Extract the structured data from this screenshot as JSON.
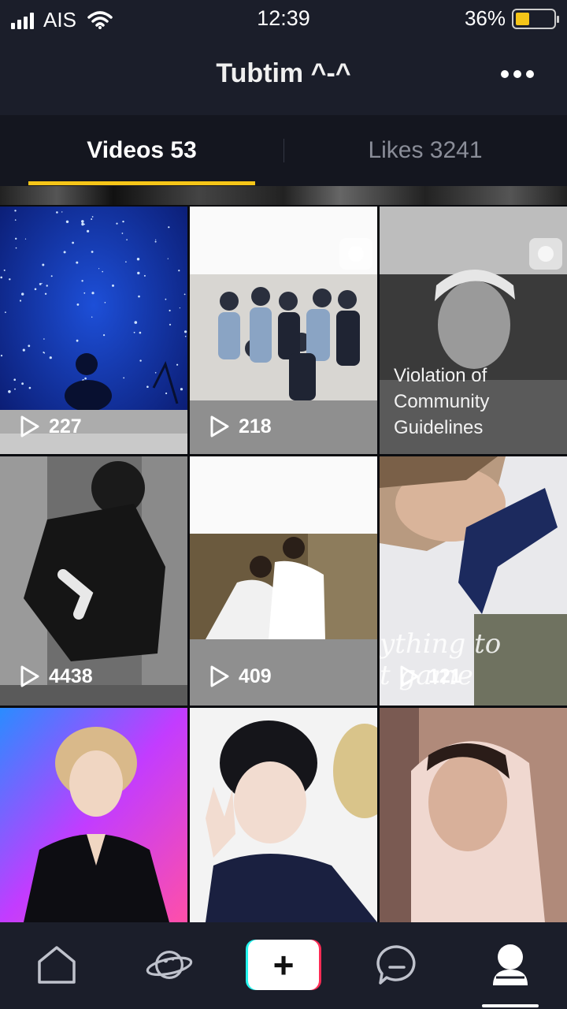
{
  "status_bar": {
    "carrier": "AIS",
    "time": "12:39",
    "battery_percent": "36%",
    "battery_level": 0.36,
    "battery_color": "#f5c518"
  },
  "header": {
    "title": "Tubtim ^-^",
    "more_icon": "more-horizontal-icon"
  },
  "tabs": [
    {
      "label": "Videos 53",
      "active": true
    },
    {
      "label": "Likes 3241",
      "active": false
    }
  ],
  "videos": [
    {
      "views": "227",
      "thumb": "starry-sky-silhouette"
    },
    {
      "views": "218",
      "thumb": "group-photo"
    },
    {
      "views": "",
      "thumb": "portrait-blurred",
      "notice": [
        "Violation of",
        "Community",
        "Guidelines"
      ]
    },
    {
      "views": "4438",
      "thumb": "bw-stage-dance"
    },
    {
      "views": "409",
      "thumb": "two-in-white"
    },
    {
      "views": "121",
      "thumb": "navy-scarf",
      "overlay_text": [
        "ything to",
        "t game"
      ]
    },
    {
      "views": "",
      "thumb": "blonde-stage"
    },
    {
      "views": "",
      "thumb": "peace-sign"
    },
    {
      "views": "",
      "thumb": "pink-hoodie"
    }
  ],
  "bottom_nav": {
    "items": [
      "home-icon",
      "discover-planet-icon",
      "create-plus-icon",
      "inbox-message-icon",
      "profile-icon"
    ],
    "create_label": "+"
  },
  "colors": {
    "accent": "#f5c518",
    "background": "#14161f",
    "bar": "#1b1e2a"
  }
}
